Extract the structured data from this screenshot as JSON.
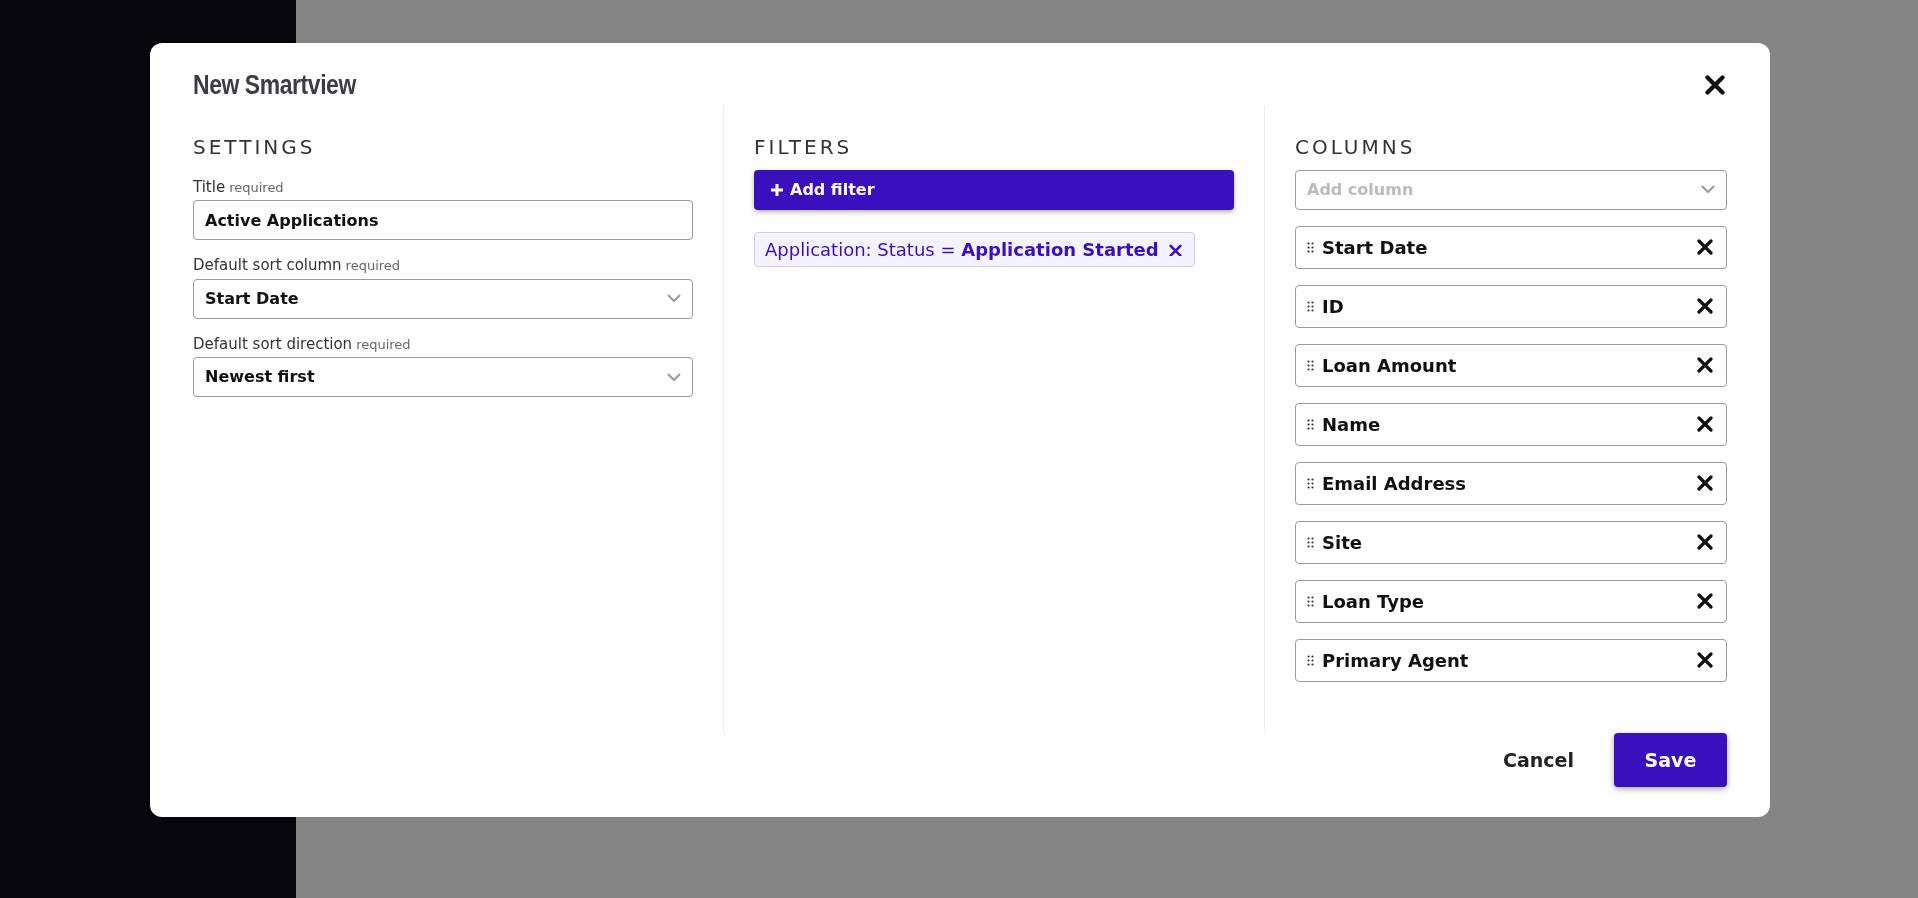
{
  "modal": {
    "title": "New Smartview",
    "settings": {
      "heading": "SETTINGS",
      "fields": [
        {
          "kind": "text",
          "label": "Title",
          "hint": "required",
          "value": "Active Applications"
        },
        {
          "kind": "select",
          "label": "Default sort column",
          "hint": "required",
          "value": "Start Date"
        },
        {
          "kind": "select",
          "label": "Default sort direction",
          "hint": "required",
          "value": "Newest first"
        }
      ]
    },
    "filters": {
      "heading": "FILTERS",
      "add_button": "Add filter",
      "chips": [
        {
          "field": "Application: Status",
          "operator": "=",
          "value": "Application Started"
        }
      ]
    },
    "columns": {
      "heading": "COLUMNS",
      "placeholder": "Add column",
      "items": [
        {
          "label": "Start Date"
        },
        {
          "label": "ID"
        },
        {
          "label": "Loan Amount"
        },
        {
          "label": "Name"
        },
        {
          "label": "Email Address"
        },
        {
          "label": "Site"
        },
        {
          "label": "Loan Type"
        },
        {
          "label": "Primary Agent"
        }
      ]
    },
    "footer": {
      "cancel": "Cancel",
      "save": "Save"
    }
  }
}
